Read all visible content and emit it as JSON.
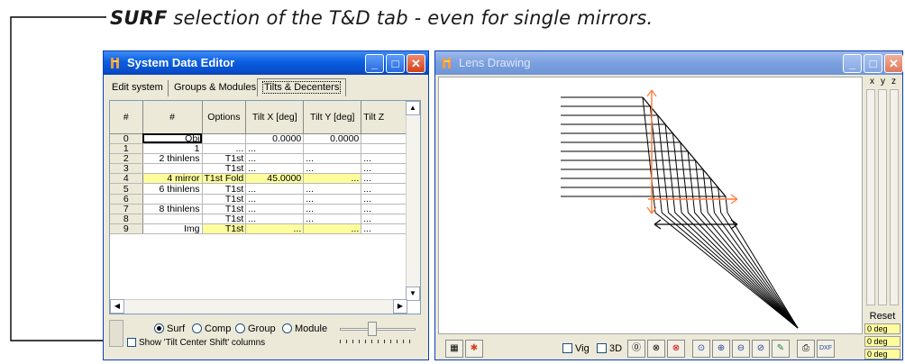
{
  "caption": {
    "bold": "SURF",
    "rest": " selection of the T&D tab - even for single mirrors."
  },
  "editor": {
    "title": "System Data Editor",
    "tabs": [
      "Edit system",
      "Groups & Modules",
      "Tilts & Decenters"
    ],
    "columns": [
      "#",
      "#",
      "Options",
      "Tilt X [deg]",
      "Tilt Y [deg]",
      "Tilt Z"
    ],
    "rows": [
      [
        "0",
        "Obj",
        "",
        "0.0000",
        "0.0000",
        ""
      ],
      [
        "1",
        "1",
        "...",
        "...",
        "",
        ""
      ],
      [
        "2",
        "2 thinlens",
        "T1st",
        "...",
        "...",
        "..."
      ],
      [
        "3",
        "",
        "T1st",
        "...",
        "...",
        "..."
      ],
      [
        "4",
        "4 mirror",
        "T1st Fold",
        "45.0000",
        "...",
        "..."
      ],
      [
        "5",
        "6 thinlens",
        "T1st",
        "...",
        "...",
        "..."
      ],
      [
        "6",
        "",
        "T1st",
        "...",
        "...",
        "..."
      ],
      [
        "7",
        "8 thinlens",
        "T1st",
        "...",
        "...",
        "..."
      ],
      [
        "8",
        "",
        "T1st",
        "...",
        "...",
        "..."
      ],
      [
        "9",
        "Img",
        "T1st",
        "...",
        "...",
        "..."
      ]
    ],
    "radios": [
      "Surf",
      "Comp",
      "Group",
      "Module"
    ],
    "selected_radio": "Surf",
    "checkbox_label": "Show 'Tilt Center Shift' columns"
  },
  "lens": {
    "title": "Lens Drawing",
    "axes": [
      "x",
      "y",
      "z"
    ],
    "reset_label": "Reset",
    "deg_values": [
      "0 deg",
      "0 deg",
      "0 deg"
    ],
    "toolbar": {
      "vig_label": "Vig",
      "threed_label": "3D"
    }
  },
  "colors": {
    "titlebar_active": "#0a5fe0",
    "highlight": "#fdfd9e",
    "chrome": "#ece9d8",
    "lens_element": "#ff7a3a"
  }
}
